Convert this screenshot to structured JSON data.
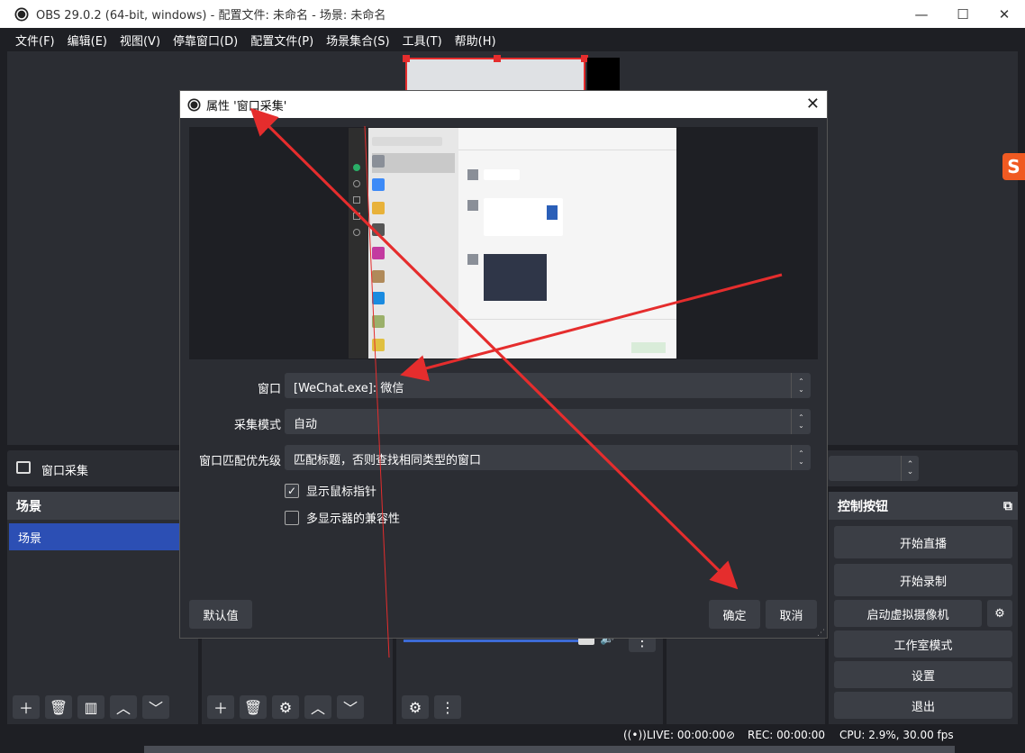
{
  "window": {
    "title": "OBS 29.0.2 (64-bit, windows) - 配置文件: 未命名 - 场景: 未命名",
    "minimize": "—",
    "maximize": "☐",
    "close": "✕"
  },
  "menu": [
    "文件(F)",
    "编辑(E)",
    "视图(V)",
    "停靠窗口(D)",
    "配置文件(P)",
    "场景集合(S)",
    "工具(T)",
    "帮助(H)"
  ],
  "source_bar": {
    "label": "窗口采集"
  },
  "scenes": {
    "header": "场景",
    "items": [
      "场景"
    ]
  },
  "controls": {
    "header": "控制按钮",
    "start_stream": "开始直播",
    "start_record": "开始录制",
    "virtual_cam": "启动虚拟摄像机",
    "studio_mode": "工作室模式",
    "settings": "设置",
    "exit": "退出"
  },
  "status": {
    "live": "LIVE: 00:00:00",
    "rec": "REC: 00:00:00",
    "cpu": "CPU: 2.9%, 30.00 fps"
  },
  "dialog": {
    "title": "属性 '窗口采集'",
    "fields": [
      {
        "label": "窗口",
        "value": "[WeChat.exe]: 微信"
      },
      {
        "label": "采集模式",
        "value": "自动"
      },
      {
        "label": "窗口匹配优先级",
        "value": "匹配标题，否则查找相同类型的窗口"
      }
    ],
    "checkbox_cursor": {
      "label": "显示鼠标指针",
      "checked": true
    },
    "checkbox_multi": {
      "label": "多显示器的兼容性",
      "checked": false
    },
    "defaults": "默认值",
    "ok": "确定",
    "cancel": "取消"
  },
  "colors": {
    "accent": "#2c4fb4",
    "annotation_arrow": "#e52d2d",
    "bg": "#1e1f24",
    "panel": "#2b2d33"
  }
}
